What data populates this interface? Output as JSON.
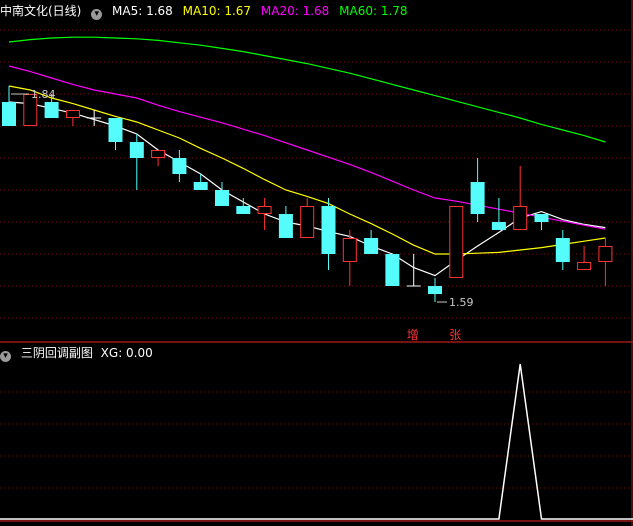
{
  "main_panel": {
    "stock_title": "中南文化(日线)",
    "ma5_label": "MA5: 1.68",
    "ma10_label": "MA10: 1.67",
    "ma20_label": "MA20: 1.68",
    "ma60_label": "MA60: 1.78",
    "high_label": "1.84",
    "low_label": "1.59",
    "marker_zeng": "增",
    "marker_zhang": "张"
  },
  "sub_panel": {
    "title": "三阴回调副图",
    "xg_label": "XG: 0.00"
  },
  "colors": {
    "bg": "#000000",
    "up": "#ff3232",
    "down": "#54fcfc",
    "ma5": "#ffffff",
    "ma10": "#ffff00",
    "ma20": "#ff00ff",
    "ma60": "#00ff00",
    "grid": "#6e1010",
    "border": "#a01818"
  },
  "chart_data": {
    "type": "candlestick",
    "y_range": [
      1.53,
      1.93
    ],
    "candles": [
      {
        "o": 1.83,
        "h": 1.85,
        "l": 1.8,
        "c": 1.8
      },
      {
        "o": 1.8,
        "h": 1.84,
        "l": 1.8,
        "c": 1.84
      },
      {
        "o": 1.83,
        "h": 1.84,
        "l": 1.81,
        "c": 1.81
      },
      {
        "o": 1.81,
        "h": 1.82,
        "l": 1.8,
        "c": 1.82
      },
      {
        "o": 1.81,
        "h": 1.82,
        "l": 1.8,
        "c": 1.81
      },
      {
        "o": 1.81,
        "h": 1.81,
        "l": 1.77,
        "c": 1.78
      },
      {
        "o": 1.78,
        "h": 1.79,
        "l": 1.72,
        "c": 1.76
      },
      {
        "o": 1.76,
        "h": 1.77,
        "l": 1.75,
        "c": 1.77
      },
      {
        "o": 1.76,
        "h": 1.77,
        "l": 1.73,
        "c": 1.74
      },
      {
        "o": 1.73,
        "h": 1.74,
        "l": 1.72,
        "c": 1.72
      },
      {
        "o": 1.72,
        "h": 1.73,
        "l": 1.7,
        "c": 1.7
      },
      {
        "o": 1.7,
        "h": 1.71,
        "l": 1.69,
        "c": 1.69
      },
      {
        "o": 1.69,
        "h": 1.71,
        "l": 1.67,
        "c": 1.7
      },
      {
        "o": 1.69,
        "h": 1.7,
        "l": 1.66,
        "c": 1.66
      },
      {
        "o": 1.66,
        "h": 1.71,
        "l": 1.66,
        "c": 1.7
      },
      {
        "o": 1.7,
        "h": 1.71,
        "l": 1.62,
        "c": 1.64
      },
      {
        "o": 1.63,
        "h": 1.67,
        "l": 1.6,
        "c": 1.66
      },
      {
        "o": 1.66,
        "h": 1.67,
        "l": 1.64,
        "c": 1.64
      },
      {
        "o": 1.64,
        "h": 1.64,
        "l": 1.6,
        "c": 1.6
      },
      {
        "o": 1.6,
        "h": 1.64,
        "l": 1.6,
        "c": 1.6
      },
      {
        "o": 1.6,
        "h": 1.61,
        "l": 1.58,
        "c": 1.59
      },
      {
        "o": 1.61,
        "h": 1.7,
        "l": 1.61,
        "c": 1.7
      },
      {
        "o": 1.73,
        "h": 1.76,
        "l": 1.68,
        "c": 1.69
      },
      {
        "o": 1.68,
        "h": 1.71,
        "l": 1.67,
        "c": 1.67
      },
      {
        "o": 1.67,
        "h": 1.75,
        "l": 1.67,
        "c": 1.7
      },
      {
        "o": 1.69,
        "h": 1.69,
        "l": 1.67,
        "c": 1.68
      },
      {
        "o": 1.66,
        "h": 1.67,
        "l": 1.62,
        "c": 1.63
      },
      {
        "o": 1.62,
        "h": 1.65,
        "l": 1.62,
        "c": 1.63
      },
      {
        "o": 1.63,
        "h": 1.66,
        "l": 1.6,
        "c": 1.65
      }
    ],
    "ma_series": [
      {
        "name": "MA5",
        "values": [
          1.83,
          1.828,
          1.822,
          1.816,
          1.808,
          1.8,
          1.79,
          1.77,
          1.755,
          1.74,
          1.72,
          1.705,
          1.69,
          1.68,
          1.675,
          1.668,
          1.662,
          1.65,
          1.64,
          1.623,
          1.613,
          1.632,
          1.65,
          1.667,
          1.685,
          1.693,
          1.683,
          1.677,
          1.673
        ]
      },
      {
        "name": "MA10",
        "values": [
          1.85,
          1.845,
          1.835,
          1.828,
          1.82,
          1.812,
          1.805,
          1.795,
          1.785,
          1.772,
          1.76,
          1.747,
          1.733,
          1.72,
          1.712,
          1.703,
          1.69,
          1.678,
          1.665,
          1.651,
          1.64,
          1.64,
          1.641,
          1.642,
          1.645,
          1.648,
          1.652,
          1.656,
          1.66
        ]
      },
      {
        "name": "MA20",
        "values": [
          1.875,
          1.868,
          1.86,
          1.852,
          1.845,
          1.84,
          1.835,
          1.826,
          1.818,
          1.811,
          1.804,
          1.796,
          1.788,
          1.779,
          1.77,
          1.761,
          1.752,
          1.742,
          1.731,
          1.72,
          1.71,
          1.706,
          1.701,
          1.696,
          1.691,
          1.686,
          1.681,
          1.676,
          1.671
        ]
      },
      {
        "name": "MA60",
        "values": [
          1.905,
          1.908,
          1.91,
          1.911,
          1.911,
          1.91,
          1.909,
          1.907,
          1.904,
          1.901,
          1.897,
          1.893,
          1.888,
          1.883,
          1.878,
          1.872,
          1.866,
          1.859,
          1.852,
          1.845,
          1.838,
          1.831,
          1.824,
          1.817,
          1.81,
          1.802,
          1.795,
          1.788,
          1.78
        ]
      }
    ],
    "sub_y_range": [
      0,
      1
    ],
    "xg_values": [
      0,
      0,
      0,
      0,
      0,
      0,
      0,
      0,
      0,
      0,
      0,
      0,
      0,
      0,
      0,
      0,
      0,
      0,
      0,
      0,
      0,
      0,
      0,
      0,
      1,
      0,
      0,
      0,
      0
    ]
  }
}
